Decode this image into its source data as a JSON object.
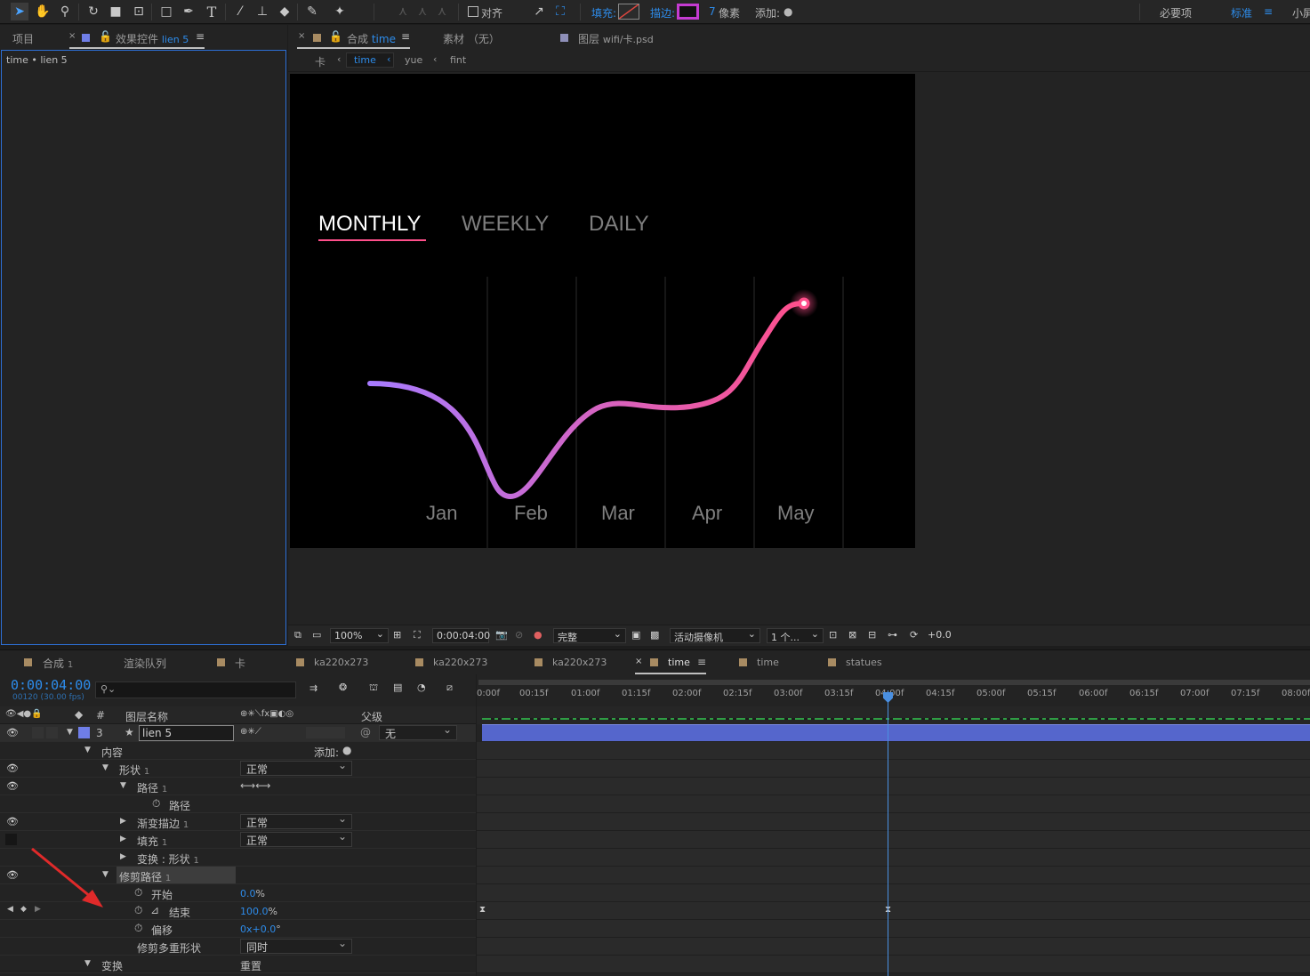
{
  "toolbar": {
    "align_label": "对齐",
    "fill_label": "填充:",
    "stroke_label": "描边:",
    "stroke_width_value": "7",
    "stroke_width_unit": "像素",
    "add_label": "添加:",
    "workspace_essentials": "必要项",
    "workspace_standard": "标准",
    "workspace_small": "小屏",
    "stroke_color": "#c43bd1",
    "fill_color": "#e0473f"
  },
  "left_panel": {
    "tab_project": "项目",
    "tab_effects": "效果控件",
    "tab_effects_layer": "lien 5",
    "breadcrumb": "time • lien 5"
  },
  "viewer_tabs": {
    "comp_label": "合成",
    "comp_name": "time",
    "footage_label": "素材",
    "footage_value": "（无）",
    "layer_label": "图层",
    "layer_value": "wifi/卡.psd",
    "nav": [
      "卡",
      "time",
      "yue",
      "fint"
    ]
  },
  "comp": {
    "tabs": [
      "MONTHLY",
      "WEEKLY",
      "DAILY"
    ],
    "active_tab": "MONTHLY",
    "months": [
      "Jan",
      "Feb",
      "Mar",
      "Apr",
      "May"
    ],
    "line_start_color": "#a77bff",
    "line_end_color": "#ff4f8b"
  },
  "viewer_bar": {
    "zoom": "100%",
    "timecode": "0:00:04:00",
    "resolution": "完整",
    "camera": "活动摄像机",
    "views": "1 个...",
    "exposure": "+0.0"
  },
  "timeline_tabs": {
    "comp1_label": "合成",
    "comp1_num": "1",
    "render_queue": "渲染队列",
    "items": [
      "卡",
      "ka220x273",
      "ka220x273",
      "ka220x273",
      "time",
      "time",
      "statues"
    ],
    "active_item": "time"
  },
  "timeline": {
    "current_time": "0:00:04:00",
    "fps_info": "00120 (30.00 fps)",
    "col_hash": "#",
    "col_layer_name": "图层名称",
    "col_parent": "父级",
    "layer_num": "3",
    "layer_name": "lien 5",
    "parent_value": "无",
    "add_label": "添加:",
    "ruler": [
      "0:00f",
      "00:15f",
      "01:00f",
      "01:15f",
      "02:00f",
      "02:15f",
      "03:00f",
      "03:15f",
      "04:00f",
      "04:15f",
      "05:00f",
      "05:15f",
      "06:00f",
      "06:15f",
      "07:00f",
      "07:15f",
      "08:00f"
    ],
    "props": {
      "contents": "内容",
      "shape1": "形状",
      "shape1_num": "1",
      "shape1_mode": "正常",
      "path1": "路径",
      "path1_num": "1",
      "path": "路径",
      "grad_stroke": "渐变描边",
      "grad_stroke_num": "1",
      "grad_stroke_mode": "正常",
      "fill": "填充",
      "fill_num": "1",
      "fill_mode": "正常",
      "transform_shape": "变换 : 形状",
      "transform_shape_num": "1",
      "trim_paths": "修剪路径",
      "trim_paths_num": "1",
      "start": "开始",
      "start_value": "0.0",
      "start_unit": "%",
      "end": "结束",
      "end_value": "100.0",
      "end_unit": "%",
      "offset": "偏移",
      "offset_value": "0x+0.0",
      "offset_unit": "°",
      "trim_multiple": "修剪多重形状",
      "trim_multiple_value": "同时",
      "transform": "变换",
      "transform_value": "重置"
    }
  }
}
